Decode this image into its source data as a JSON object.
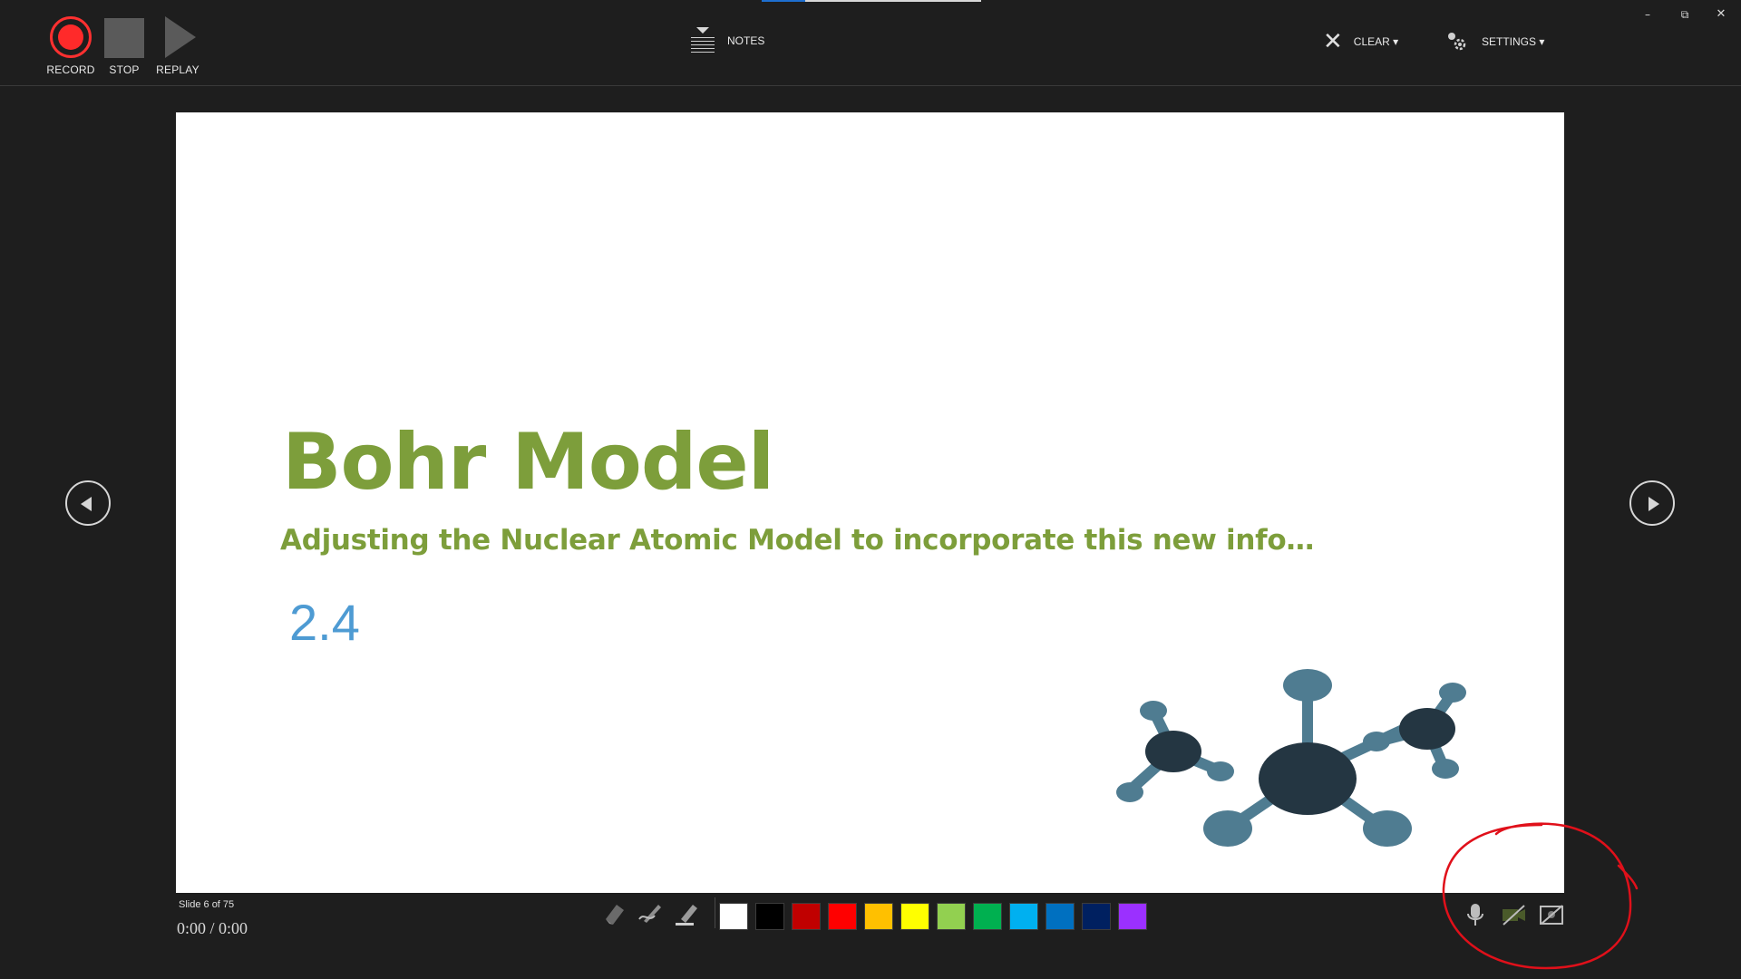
{
  "toolbar": {
    "record_label": "RECORD",
    "stop_label": "STOP",
    "replay_label": "REPLAY",
    "notes_label": "NOTES",
    "clear_label": "CLEAR ▾",
    "settings_label": "SETTINGS ▾"
  },
  "window_controls": {
    "minimize": "–",
    "restore": "⧉",
    "close": "✕"
  },
  "slide": {
    "title": "Bohr Model",
    "subtitle": "Adjusting the Nuclear Atomic Model to incorporate this new info…",
    "number_label": "2.4"
  },
  "status": {
    "slide_counter": "Slide 6 of 75",
    "timer": "0:00  /  0:00"
  },
  "pen_tools": [
    "eraser-icon",
    "pen-icon",
    "highlighter-icon"
  ],
  "ink_colors": [
    "#ffffff",
    "#000000",
    "#c00000",
    "#ff0000",
    "#ffc000",
    "#ffff00",
    "#92d050",
    "#00b050",
    "#00b0f0",
    "#0070c0",
    "#002060",
    "#9b30ff"
  ],
  "media_icons": [
    "microphone-icon",
    "camera-off-icon",
    "camera-preview-off-icon"
  ],
  "colors": {
    "title_green": "#7d9e3b",
    "number_blue": "#4e9bd3",
    "record_red": "#ff2a2a",
    "annotation_red": "#e0101a"
  }
}
